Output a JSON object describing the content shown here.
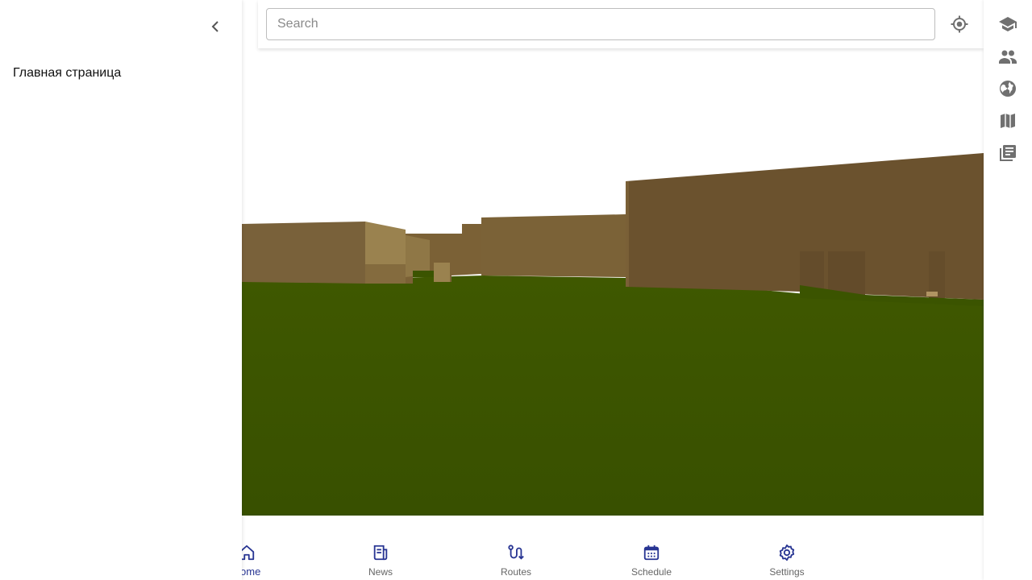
{
  "drawer": {
    "home_link": "Главная страница",
    "collapse_icon": "chevron-left-icon"
  },
  "search": {
    "placeholder": "Search",
    "value": "",
    "locate_icon": "my-location-icon"
  },
  "right_rail": {
    "items": [
      {
        "icon": "school-icon"
      },
      {
        "icon": "people-icon"
      },
      {
        "icon": "globe-icon"
      },
      {
        "icon": "map-icon"
      },
      {
        "icon": "library-books-icon"
      }
    ]
  },
  "bottom_nav": {
    "items": [
      {
        "label": "Home",
        "icon": "home-icon",
        "active": true
      },
      {
        "label": "News",
        "icon": "newspaper-icon",
        "active": false
      },
      {
        "label": "Routes",
        "icon": "route-icon",
        "active": false
      },
      {
        "label": "Schedule",
        "icon": "calendar-icon",
        "active": false
      },
      {
        "label": "Settings",
        "icon": "settings-icon",
        "active": false
      }
    ]
  },
  "colors": {
    "accent": "#283593",
    "ground": "#3b5400",
    "building": "#74592f",
    "icon_gray": "#707070"
  }
}
